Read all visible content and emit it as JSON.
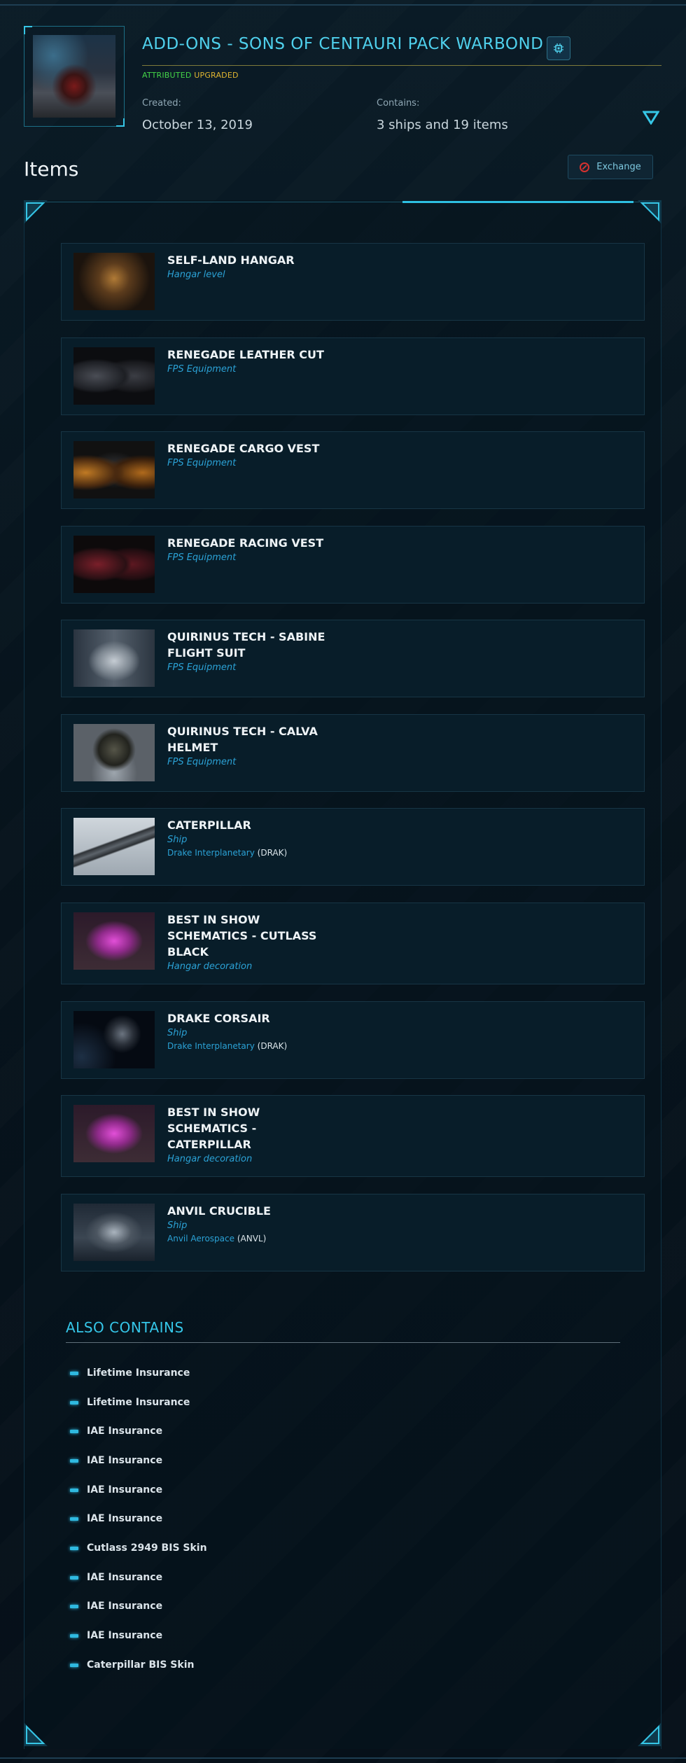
{
  "pledge": {
    "title": "ADD-ONS - SONS OF CENTAURI PACK WARBOND",
    "badges": {
      "attributed": "ATTRIBUTED",
      "upgraded": "UPGRADED"
    },
    "created_label": "Created:",
    "created_value": "October 13, 2019",
    "contains_label": "Contains:",
    "contains_value": "3 ships and 19 items",
    "icons": {
      "chip": "chip-icon",
      "expand": "triangle-down-icon"
    }
  },
  "items_section": {
    "title": "Items",
    "exchange_label": "Exchange",
    "exchange_icon": "no-entry-icon"
  },
  "items": [
    {
      "name": "SELF-LAND HANGAR",
      "type": "Hangar level",
      "maker": "",
      "maker_code": ""
    },
    {
      "name": "RENEGADE LEATHER CUT",
      "type": "FPS Equipment",
      "maker": "",
      "maker_code": ""
    },
    {
      "name": "RENEGADE CARGO VEST",
      "type": "FPS Equipment",
      "maker": "",
      "maker_code": ""
    },
    {
      "name": "RENEGADE RACING VEST",
      "type": "FPS Equipment",
      "maker": "",
      "maker_code": ""
    },
    {
      "name": "QUIRINUS TECH - SABINE FLIGHT SUIT",
      "type": "FPS Equipment",
      "maker": "",
      "maker_code": ""
    },
    {
      "name": "QUIRINUS TECH - CALVA HELMET",
      "type": "FPS Equipment",
      "maker": "",
      "maker_code": ""
    },
    {
      "name": "CATERPILLAR",
      "type": "Ship",
      "maker": "Drake Interplanetary",
      "maker_code": "(DRAK)"
    },
    {
      "name": "BEST IN SHOW SCHEMATICS - CUTLASS BLACK",
      "type": "Hangar decoration",
      "maker": "",
      "maker_code": ""
    },
    {
      "name": "DRAKE CORSAIR",
      "type": "Ship",
      "maker": "Drake Interplanetary",
      "maker_code": "(DRAK)"
    },
    {
      "name": "BEST IN SHOW SCHEMATICS - CATERPILLAR",
      "type": "Hangar decoration",
      "maker": "",
      "maker_code": ""
    },
    {
      "name": "ANVIL CRUCIBLE",
      "type": "Ship",
      "maker": "Anvil Aerospace",
      "maker_code": "(ANVL)"
    }
  ],
  "also_contains": {
    "title": "ALSO CONTAINS",
    "items": [
      "Lifetime Insurance",
      "Lifetime Insurance",
      "IAE Insurance",
      "IAE Insurance",
      "IAE Insurance",
      "IAE Insurance",
      "Cutlass 2949 BIS Skin",
      "IAE Insurance",
      "IAE Insurance",
      "IAE Insurance",
      "Caterpillar BIS Skin"
    ]
  },
  "colors": {
    "accent": "#4fd0ec",
    "attributed": "#44d548",
    "upgraded": "#e0b531",
    "item_type": "#2ba2d6",
    "background": "#06131c"
  }
}
